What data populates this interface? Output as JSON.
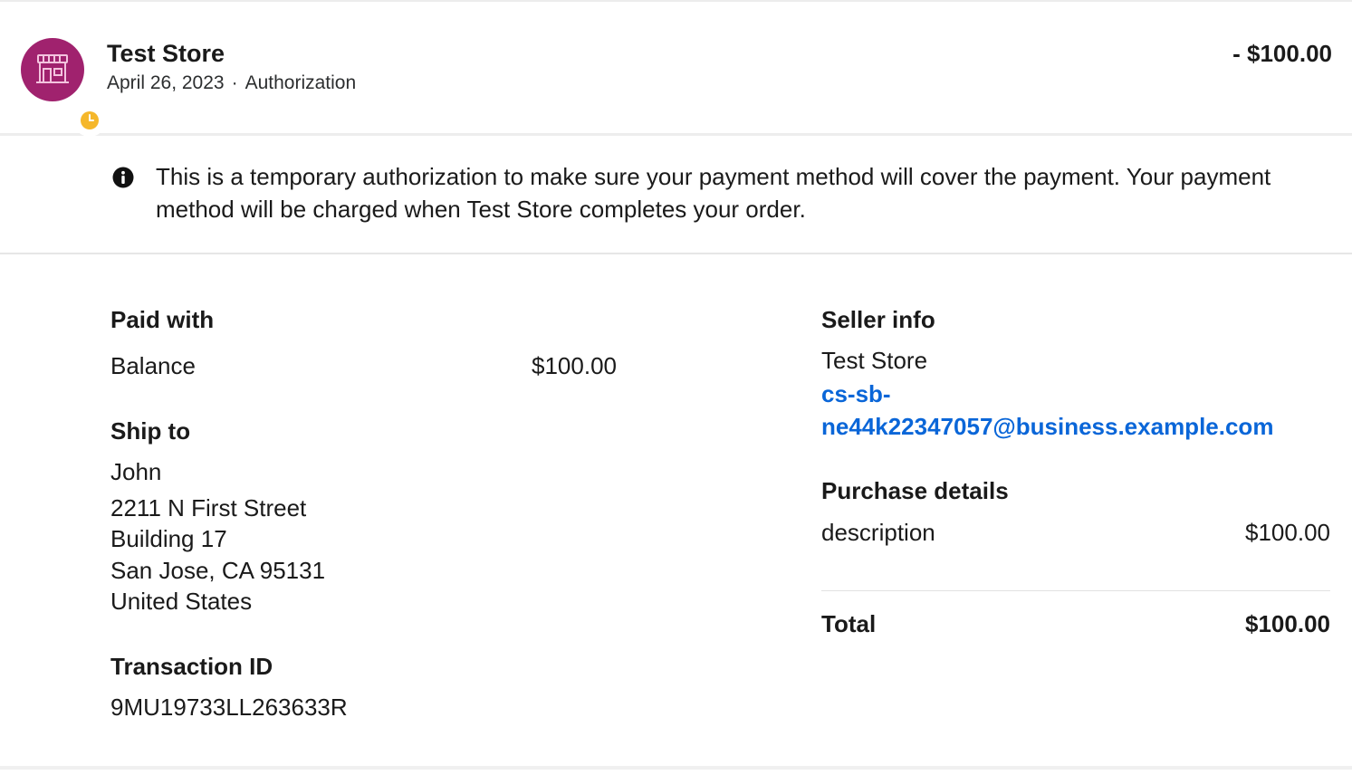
{
  "header": {
    "merchant_name": "Test Store",
    "date": "April 26, 2023",
    "separator": "·",
    "transaction_type": "Authorization",
    "amount": "- $100.00",
    "avatar_icon": "store-icon",
    "badge_icon": "clock-icon",
    "avatar_color": "#a0226e",
    "badge_color": "#f5b72b"
  },
  "notice": {
    "icon": "info-icon",
    "text": "This is a temporary authorization to make sure your payment method will cover the payment. Your payment method will be charged when Test Store completes your order."
  },
  "paid_with": {
    "title": "Paid with",
    "method": "Balance",
    "amount": "$100.00"
  },
  "ship_to": {
    "title": "Ship to",
    "name": "John",
    "line1": "2211 N First Street",
    "line2": "Building 17",
    "line3": "San Jose, CA 95131",
    "line4": "United States"
  },
  "transaction": {
    "title": "Transaction ID",
    "id": "9MU19733LL263633R"
  },
  "seller_info": {
    "title": "Seller info",
    "name": "Test Store",
    "email_part1": "cs-sb-",
    "email_part2": "ne44k22347057@business.example.com",
    "link_color": "#0a66d8"
  },
  "purchase_details": {
    "title": "Purchase details",
    "item_description": "description",
    "item_amount": "$100.00",
    "total_label": "Total",
    "total_amount": "$100.00"
  }
}
